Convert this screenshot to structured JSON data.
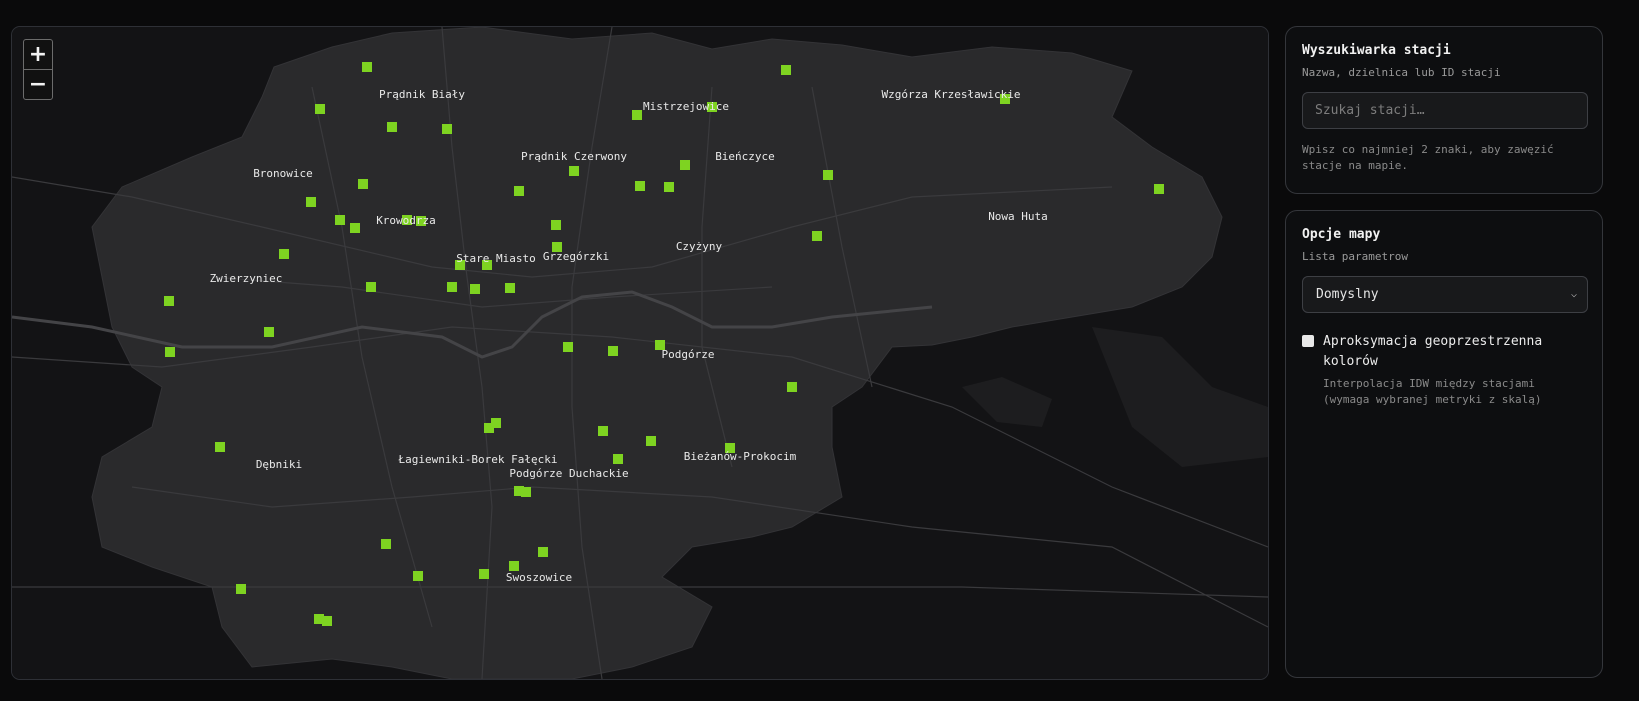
{
  "map": {
    "zoom_in_label": "+",
    "zoom_out_label": "−",
    "station_color": "#7ed321",
    "district_labels": [
      "Prądnik Biały",
      "Mistrzejowice",
      "Wzgórza Krzesławickie",
      "Prądnik Czerwony",
      "Bieńczyce",
      "Bronowice",
      "Krowodrza",
      "Nowa Huta",
      "Czyżyny",
      "Stare Miasto",
      "Grzegórzki",
      "Zwierzyniec",
      "Podgórze",
      "Dębniki",
      "Łagiewniki-Borek Fałęcki",
      "Bieżanów-Prokocim",
      "Podgórze Duchackie",
      "Swoszowice"
    ]
  },
  "search": {
    "title": "Wyszukiwarka stacji",
    "subtitle": "Nazwa, dzielnica lub ID stacji",
    "placeholder": "Szukaj stacji…",
    "hint": "Wpisz co najmniej 2 znaki, aby zawęzić stacje na mapie."
  },
  "options": {
    "title": "Opcje mapy",
    "subtitle": "Lista parametrow",
    "select_value": "Domyslny",
    "checkbox_label": "Aproksymacja geoprzestrzenna kolorów",
    "checkbox_desc": "Interpolacja IDW między stacjami (wymaga wybranej metryki z skalą)"
  }
}
